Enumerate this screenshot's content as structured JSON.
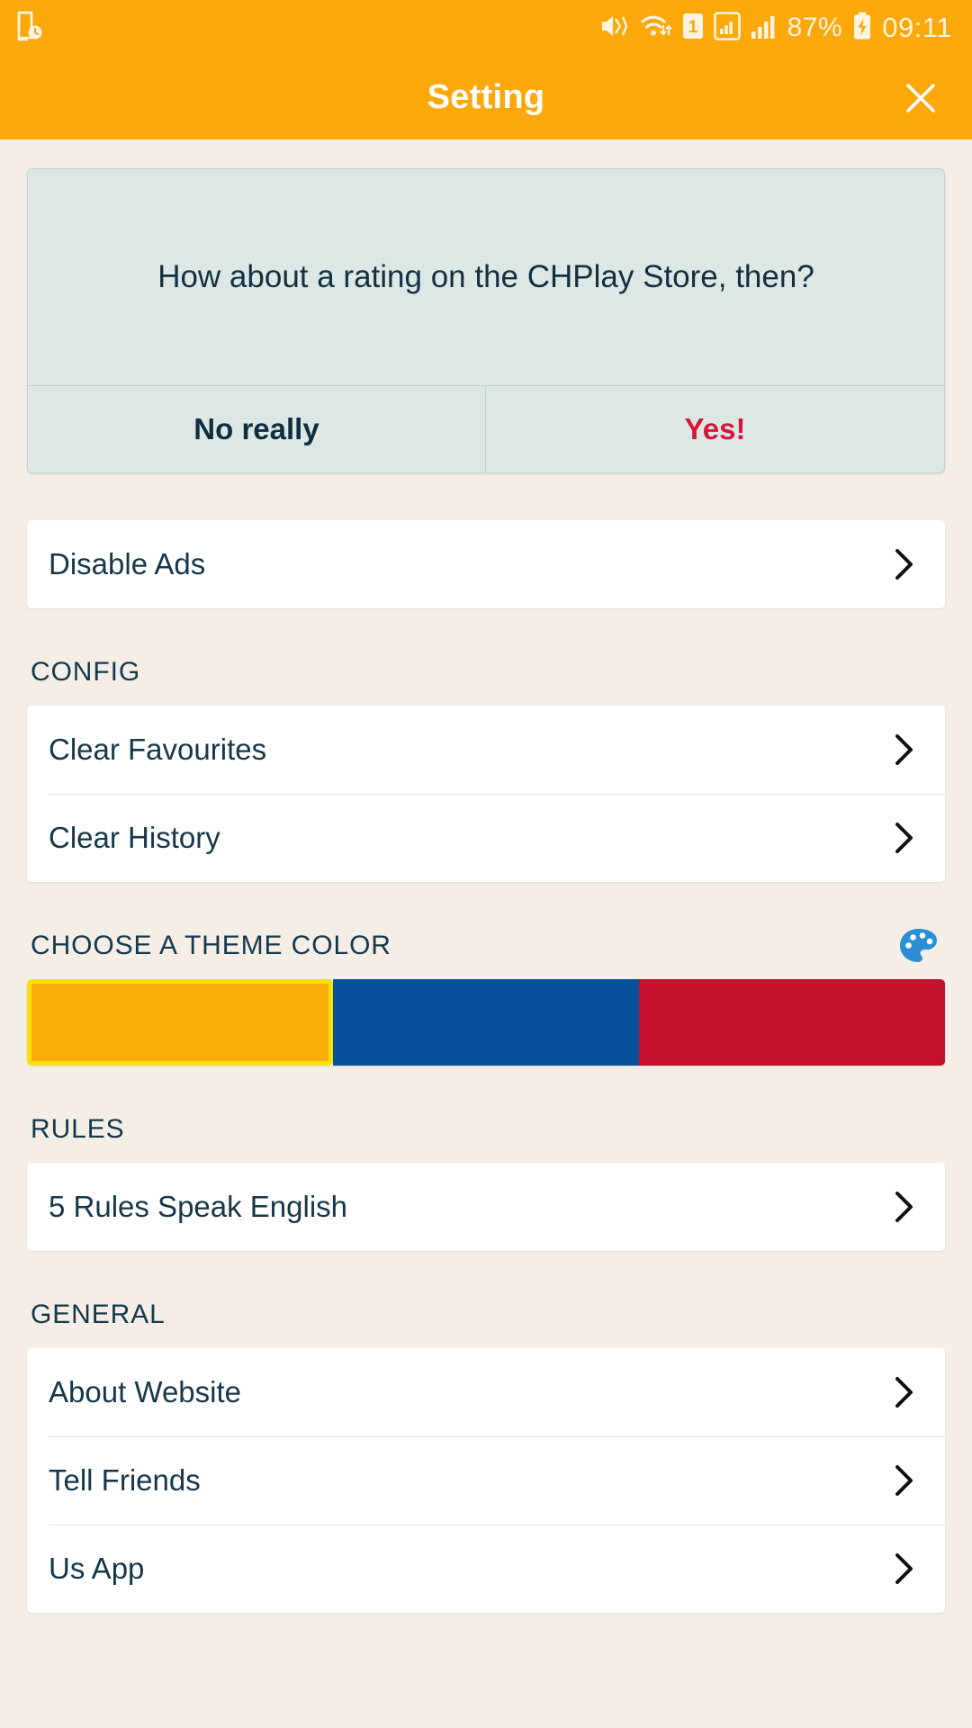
{
  "status_bar": {
    "left_icons": [
      {
        "name": "file-clock-icon",
        "glyph": "doc-clock"
      }
    ],
    "right_icons": [
      {
        "name": "mute-vibrate-icon",
        "glyph": "mute"
      },
      {
        "name": "wifi-transfer-icon",
        "glyph": "wifi"
      },
      {
        "name": "sim-1-icon",
        "glyph": "sim",
        "label": "1"
      },
      {
        "name": "mobile-data-boxed-icon",
        "glyph": "data-box"
      },
      {
        "name": "signal-bars-icon",
        "glyph": "bars"
      }
    ],
    "battery_percent": "87%",
    "battery_charging": true,
    "clock": "09:11"
  },
  "app_bar": {
    "title": "Setting",
    "close_label": "✕"
  },
  "rating_dialog": {
    "message": "How about a rating on the CHPlay Store, then?",
    "decline_label": "No really",
    "accept_label": "Yes!",
    "accent_color": "#d6173a",
    "background": "#dde8e6"
  },
  "promo": {
    "items": [
      {
        "label": "Disable Ads",
        "chevron": "›"
      }
    ]
  },
  "sections": [
    {
      "id": "config",
      "title": "CONFIG",
      "icon": null,
      "items": [
        {
          "label": "Clear Favourites",
          "chevron": "›"
        },
        {
          "label": "Clear History",
          "chevron": "›"
        }
      ]
    },
    {
      "id": "rules",
      "title": "RULES",
      "icon": null,
      "items": [
        {
          "label": "5 Rules Speak English",
          "chevron": "›"
        }
      ]
    },
    {
      "id": "general",
      "title": "GENERAL",
      "icon": null,
      "items": [
        {
          "label": "About Website",
          "chevron": "›"
        },
        {
          "label": "Tell Friends",
          "chevron": "›"
        },
        {
          "label": "Us App",
          "chevron": "›"
        }
      ]
    }
  ],
  "theme": {
    "title": "CHOOSE A THEME COLOR",
    "icon_name": "palette-icon",
    "selected_index": 0,
    "selection_outline": "#F5E010",
    "swatches": [
      {
        "name": "orange",
        "hex": "#FBAE0B"
      },
      {
        "name": "blue",
        "hex": "#09509A"
      },
      {
        "name": "red",
        "hex": "#C3102C"
      }
    ]
  },
  "palette_colors": {
    "page_background": "#f4eee7",
    "app_bar": "#FBA80B",
    "card": "#ffffff",
    "text_primary": "#16374a"
  }
}
